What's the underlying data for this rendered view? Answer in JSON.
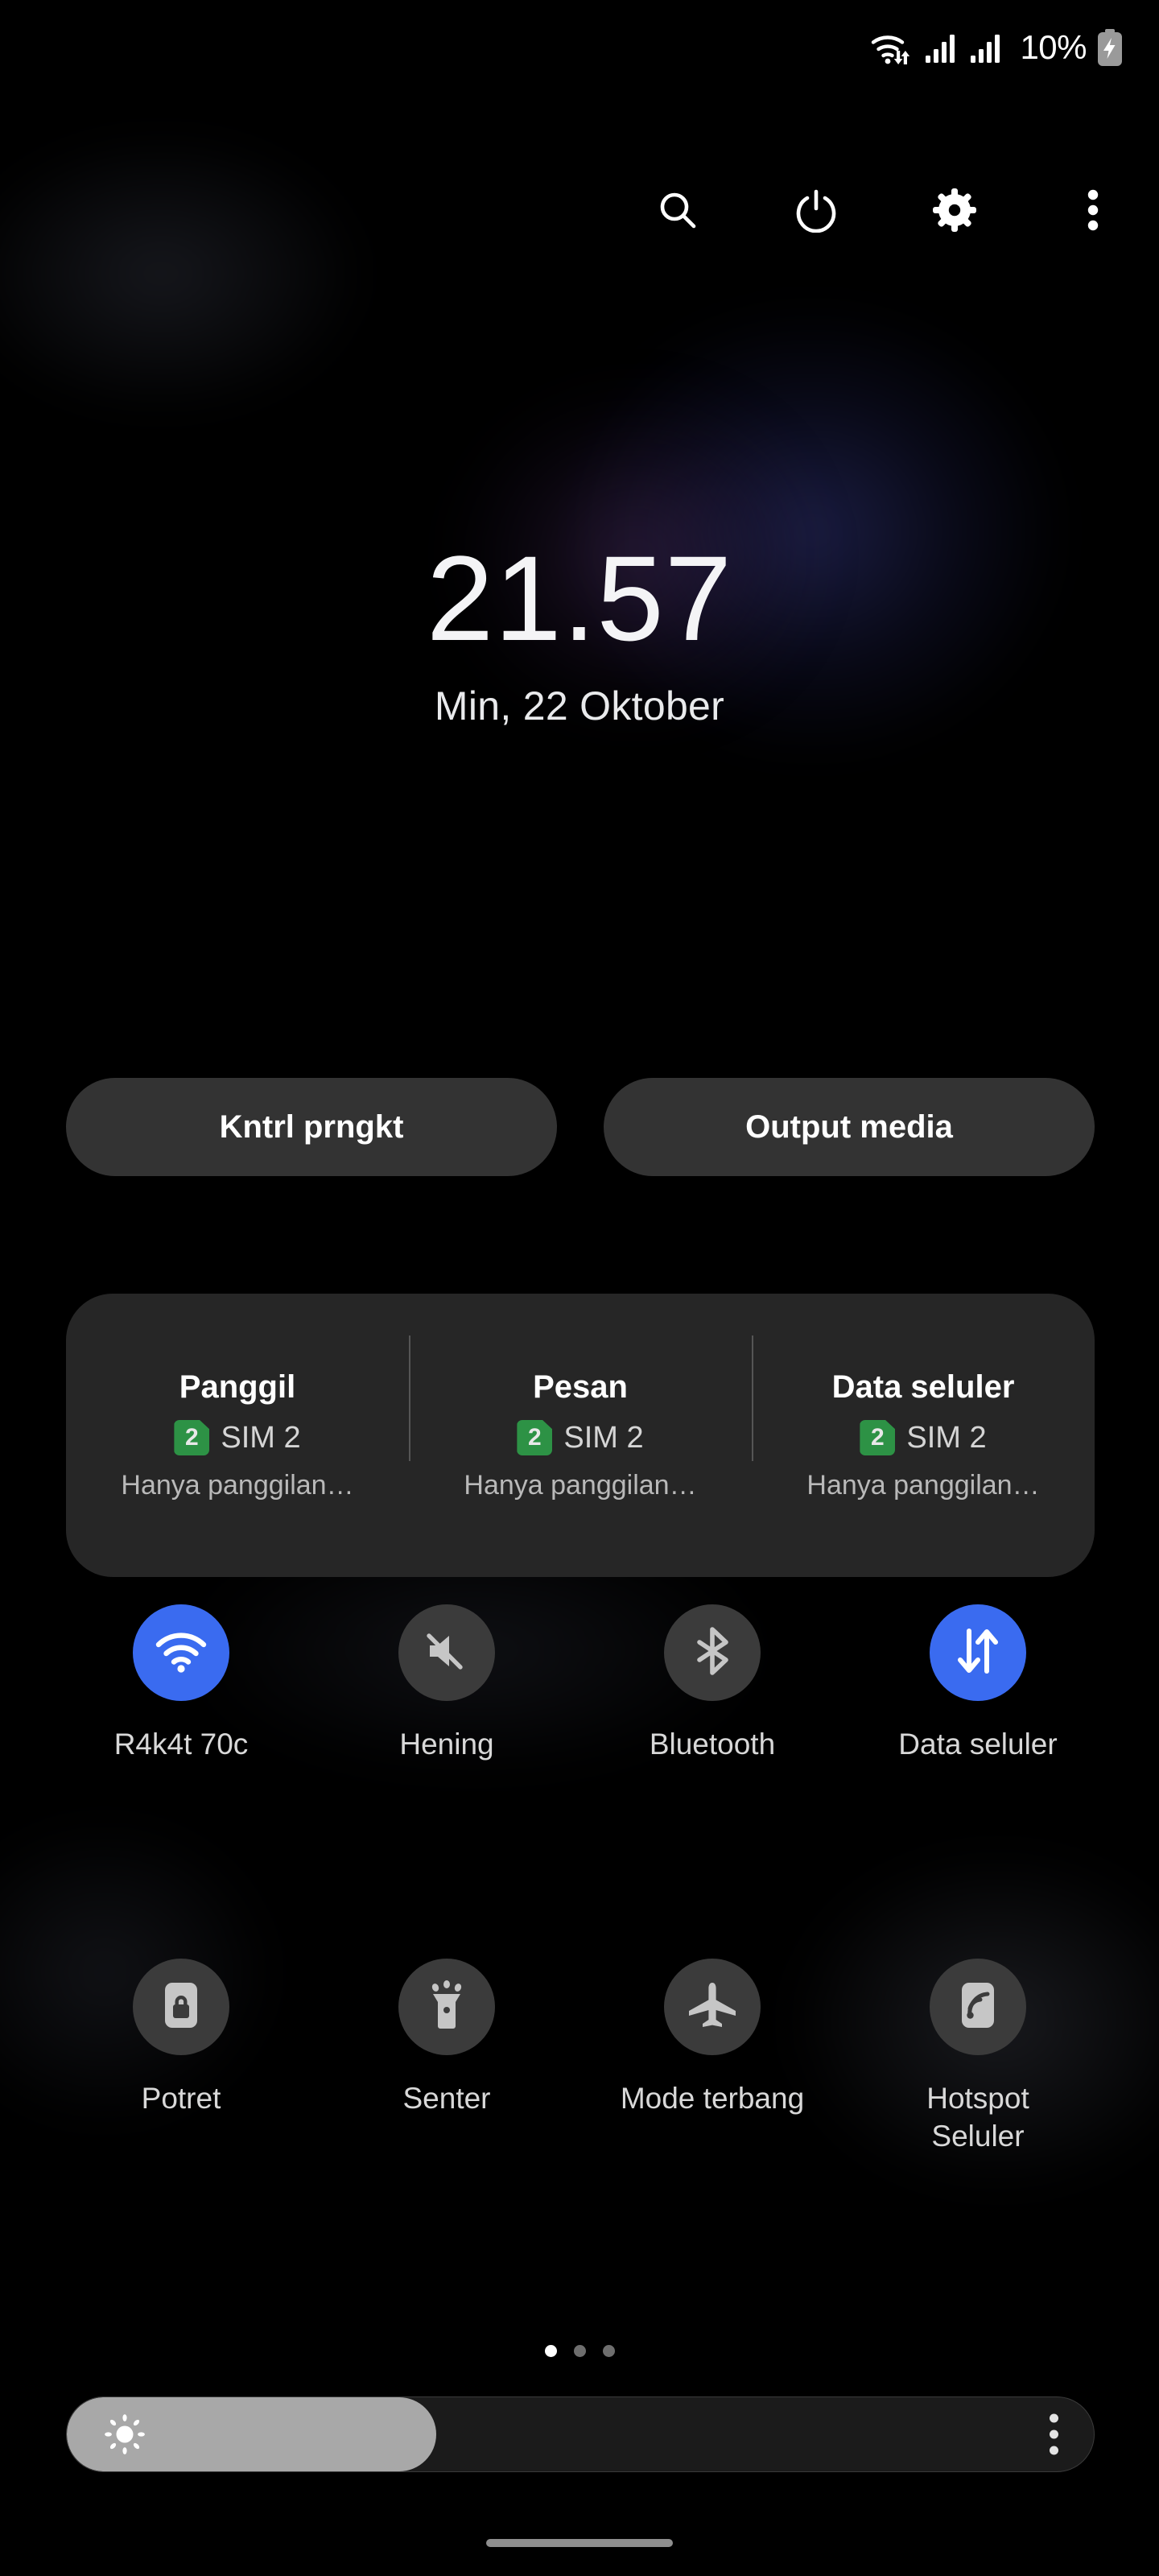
{
  "status_bar": {
    "wifi_icon": "wifi-data-arrows-icon",
    "signal_1_icon": "cellular-signal-icon",
    "signal_2_icon": "cellular-signal-icon",
    "battery_percent": "10%",
    "battery_icon": "battery-charging-icon"
  },
  "header": {
    "buttons": [
      {
        "name": "search-icon",
        "label": "Cari"
      },
      {
        "name": "power-icon",
        "label": "Daya"
      },
      {
        "name": "gear-icon",
        "label": "Setelan"
      },
      {
        "name": "overflow-menu-icon",
        "label": "Lainnya"
      }
    ]
  },
  "clock": {
    "time": "21.57",
    "date": "Min, 22 Oktober"
  },
  "pills": [
    {
      "label": "Kntrl prngkt"
    },
    {
      "label": "Output media"
    }
  ],
  "sim_panel": {
    "columns": [
      {
        "title": "Panggil",
        "chip": "2",
        "sim": "SIM 2",
        "status": "Hanya panggilan…"
      },
      {
        "title": "Pesan",
        "chip": "2",
        "sim": "SIM 2",
        "status": "Hanya panggilan…"
      },
      {
        "title": "Data seluler",
        "chip": "2",
        "sim": "SIM 2",
        "status": "Hanya panggilan…"
      }
    ]
  },
  "toggles_row_1": [
    {
      "label": "R4k4t 70c",
      "icon": "wifi-icon",
      "state": "on"
    },
    {
      "label": "Hening",
      "icon": "volume-mute-icon",
      "state": "off"
    },
    {
      "label": "Bluetooth",
      "icon": "bluetooth-icon",
      "state": "off"
    },
    {
      "label": "Data seluler",
      "icon": "data-transfer-arrows-icon",
      "state": "on"
    }
  ],
  "toggles_row_2": [
    {
      "label": "Potret",
      "icon": "rotation-lock-icon",
      "state": "off"
    },
    {
      "label": "Senter",
      "icon": "flashlight-icon",
      "state": "off"
    },
    {
      "label": "Mode terbang",
      "icon": "airplane-icon",
      "state": "off"
    },
    {
      "label": "Hotspot Seluler",
      "icon": "hotspot-icon",
      "state": "off"
    }
  ],
  "page_dots": {
    "count": 3,
    "active_index": 0
  },
  "brightness": {
    "fill_percent": 36,
    "sun_icon": "brightness-sun-icon",
    "menu_icon": "overflow-menu-icon"
  },
  "colors": {
    "accent_blue": "#3a6bf0",
    "sim_green": "#2d9245",
    "inactive_circle": "#3b3b3b",
    "panel_gray": "#262626",
    "pill_gray": "#333333",
    "slider_fill": "#a8a8a8"
  }
}
